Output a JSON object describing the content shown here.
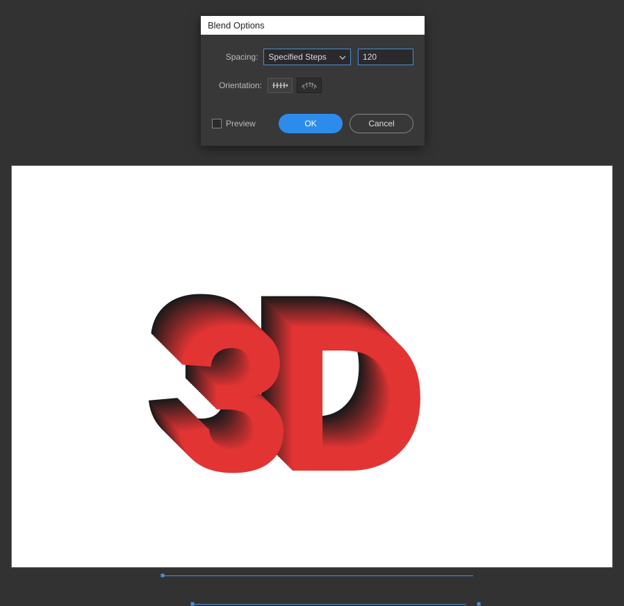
{
  "dialog": {
    "title": "Blend Options",
    "spacing_label": "Spacing:",
    "spacing_mode": "Specified Steps",
    "spacing_value": "120",
    "orientation_label": "Orientation:",
    "preview_label": "Preview",
    "ok_label": "OK",
    "cancel_label": "Cancel",
    "preview_checked": false,
    "orientation_selected": "path"
  },
  "artwork": {
    "text": "3D",
    "front_color": "#e33434",
    "back_color": "#1a1a1a"
  }
}
